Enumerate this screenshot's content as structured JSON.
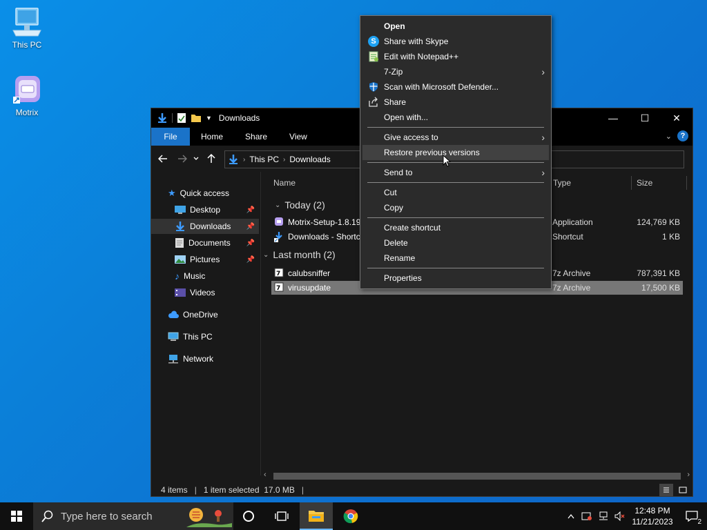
{
  "desktop": {
    "icons": [
      {
        "label": "This PC"
      },
      {
        "label": "Motrix"
      }
    ]
  },
  "explorer": {
    "title": "Downloads",
    "window_controls": {
      "minimize": "—",
      "maximize": "☐",
      "close": "✕"
    },
    "ribbon_tabs": [
      "File",
      "Home",
      "Share",
      "View"
    ],
    "address": {
      "crumbs": [
        "This PC",
        "Downloads"
      ]
    },
    "nav": {
      "quick_access": "Quick access",
      "items": [
        {
          "label": "Desktop",
          "pinned": true
        },
        {
          "label": "Downloads",
          "pinned": true,
          "selected": true
        },
        {
          "label": "Documents",
          "pinned": true
        },
        {
          "label": "Pictures",
          "pinned": true
        },
        {
          "label": "Music",
          "pinned": false
        },
        {
          "label": "Videos",
          "pinned": false
        }
      ],
      "onedrive": "OneDrive",
      "thispc": "This PC",
      "network": "Network"
    },
    "columns": {
      "name": "Name",
      "type": "Type",
      "size": "Size"
    },
    "groups": [
      {
        "label": "Today (2)",
        "files": [
          {
            "name": "Motrix-Setup-1.8.19",
            "type": "Application",
            "size": "124,769 KB"
          },
          {
            "name": "Downloads - Shortc",
            "type": "Shortcut",
            "size": "1 KB"
          }
        ]
      },
      {
        "label": "Last month (2)",
        "files": [
          {
            "name": "calubsniffer",
            "type": "7z Archive",
            "size": "787,391 KB"
          },
          {
            "name": "virusupdate",
            "type": "7z Archive",
            "size": "17,500 KB",
            "selected": true
          }
        ]
      }
    ],
    "status": {
      "items": "4 items",
      "selection": "1 item selected  17.0 MB"
    }
  },
  "context_menu": {
    "items": [
      {
        "label": "Open",
        "bold": true
      },
      {
        "label": "Share with Skype",
        "icon": "skype-icon"
      },
      {
        "label": "Edit with Notepad++",
        "icon": "notepad-plus-icon"
      },
      {
        "label": "7-Zip",
        "submenu": true
      },
      {
        "label": "Scan with Microsoft Defender...",
        "icon": "defender-shield-icon"
      },
      {
        "label": "Share",
        "icon": "share-icon"
      },
      {
        "label": "Open with..."
      },
      {
        "label": "Give access to",
        "submenu": true
      },
      {
        "label": "Restore previous versions",
        "hover": true
      },
      {
        "label": "Send to",
        "submenu": true
      },
      {
        "label": "Cut"
      },
      {
        "label": "Copy"
      },
      {
        "label": "Create shortcut"
      },
      {
        "label": "Delete"
      },
      {
        "label": "Rename"
      },
      {
        "label": "Properties"
      }
    ]
  },
  "taskbar": {
    "search_placeholder": "Type here to search",
    "clock": {
      "time": "12:48 PM",
      "date": "11/21/2023"
    },
    "notifications": "2"
  },
  "colors": {
    "accent": "#1a73c9",
    "menu_bg": "#2b2b2b",
    "window_bg": "#191919"
  }
}
